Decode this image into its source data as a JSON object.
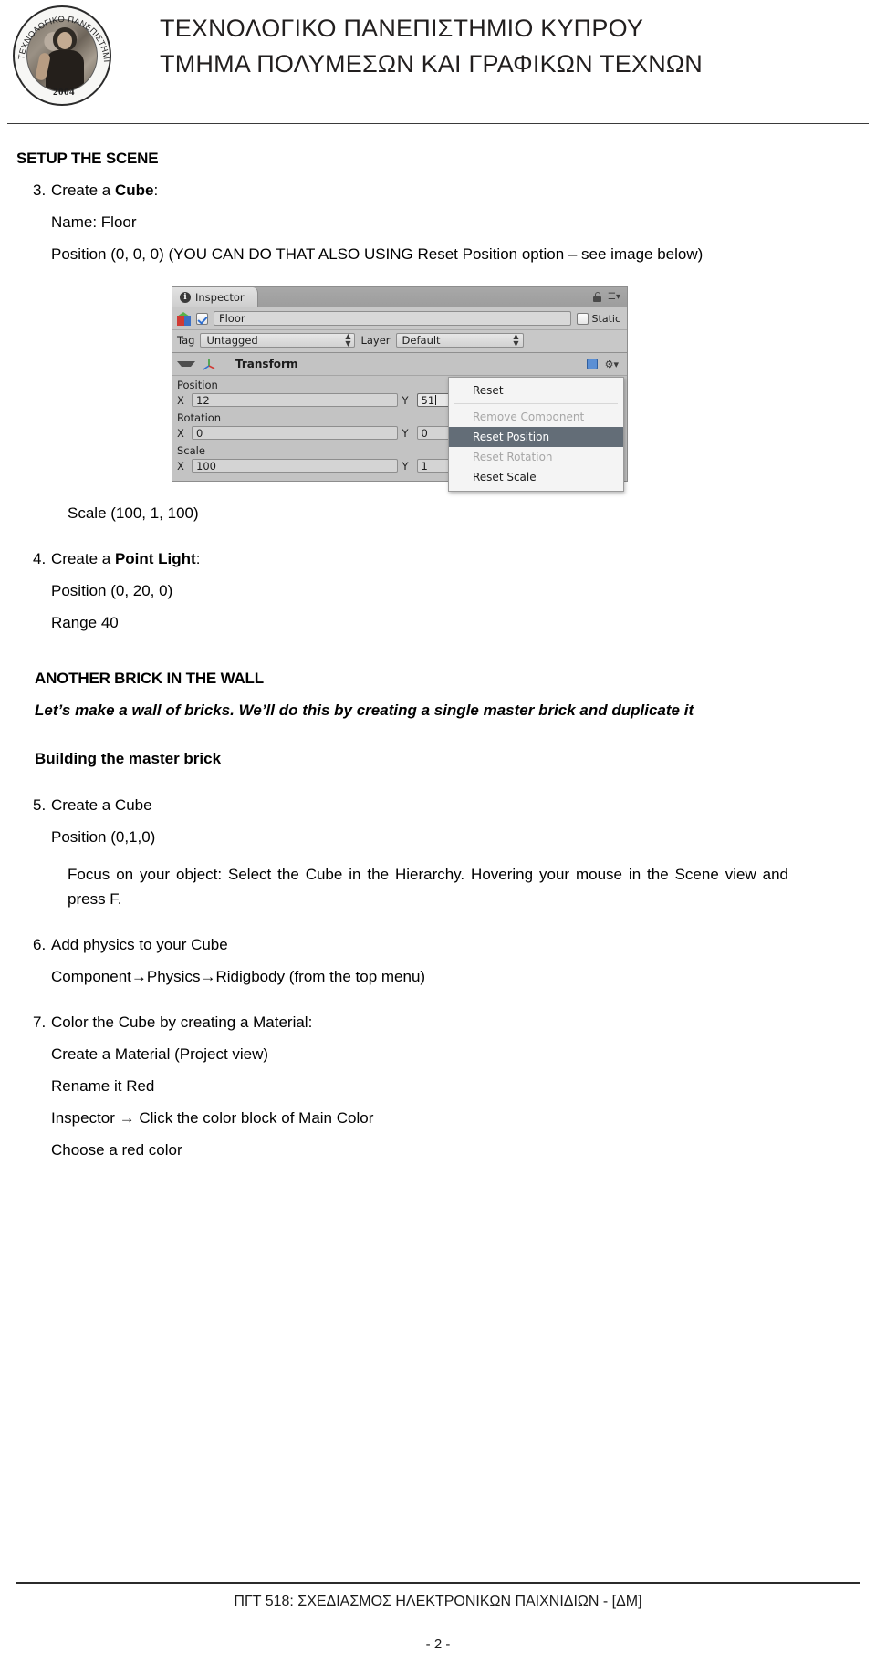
{
  "header": {
    "logo": {
      "ring_text_top": "ΤΕΧΝΟΛΟΓΙΚΟ ΠΑΝΕΠΙΣΤΗΜΙΟ ΚΥΠΡΟΥ",
      "year": "2004"
    },
    "line1": "ΤΕΧΝΟΛΟΓΙΚΟ ΠΑΝΕΠΙΣΤΗΜΙΟ ΚΥΠΡΟΥ",
    "line2": "ΤΜΗΜΑ ΠΟΛΥΜΕΣΩΝ ΚΑΙ ΓΡΑΦΙΚΩΝ ΤΕΧΝΩΝ"
  },
  "body": {
    "setup_heading": "SETUP THE SCENE",
    "item3": {
      "num": "3.",
      "line1_pre": "Create a ",
      "line1_bold": "Cube",
      "line1_post": ":",
      "name_line": "Name: Floor",
      "position_line": "Position (0, 0, 0) (YOU CAN DO THAT ALSO USING Reset Position option – see image below)",
      "scale_line": "Scale (100, 1, 100)"
    },
    "item4": {
      "num": "4.",
      "line1_pre": "Create a ",
      "line1_bold": "Point Light",
      "line1_post": ":",
      "position_line": "Position (0, 20, 0)",
      "range_line": "Range 40"
    },
    "brick_heading": "ANOTHER BRICK IN THE WALL",
    "brick_intro": "Let’s make a wall of bricks. We’ll do this by creating a single master brick and duplicate it",
    "master_brick_heading": "Building the master brick",
    "item5": {
      "num": "5.",
      "line1": "Create a Cube",
      "position_line": "Position (0,1,0)"
    },
    "focus_para": "Focus on your object: Select the Cube in the Hierarchy. Hovering your mouse in the Scene view and press F.",
    "item6": {
      "num": "6.",
      "line1": "Add physics to your Cube",
      "line2": "Component→Physics→Ridigbody (from the top menu)"
    },
    "item7": {
      "num": "7.",
      "line1": "Color the Cube by creating a Material:",
      "line2": "Create a Material (Project view)",
      "line3": "Rename it Red",
      "line4": "Inspector → Click the color block of Main Color",
      "line5": "Choose a red color"
    }
  },
  "inspector": {
    "tab_label": "Inspector",
    "tab_info_glyph": "i",
    "object_name": "Floor",
    "static_label": "Static",
    "tag_label": "Tag",
    "tag_value": "Untagged",
    "layer_label": "Layer",
    "layer_value": "Default",
    "component_title": "Transform",
    "position_label": "Position",
    "position_x_axis": "X",
    "position_x": "12",
    "position_y_axis": "Y",
    "position_y": "51",
    "rotation_label": "Rotation",
    "rotation_x_axis": "X",
    "rotation_x": "0",
    "rotation_y_axis": "Y",
    "rotation_y": "0",
    "scale_label": "Scale",
    "scale_x_axis": "X",
    "scale_x": "100",
    "scale_y_axis": "Y",
    "scale_y": "1",
    "context_menu": [
      {
        "label": "Reset",
        "state": "normal"
      },
      {
        "label": "Remove Component",
        "state": "disabled"
      },
      {
        "label": "Reset Position",
        "state": "highlight"
      },
      {
        "label": "Reset Rotation",
        "state": "disabled"
      },
      {
        "label": "Reset Scale",
        "state": "normal"
      }
    ]
  },
  "footer": {
    "course": "ΠΓΤ 518: ΣΧΕΔΙΑΣΜΟΣ ΗΛΕΚΤΡΟΝΙΚΩΝ ΠΑΙΧΝΙΔΙΩΝ - [ΔΜ]",
    "page_number": "- 2 -"
  }
}
